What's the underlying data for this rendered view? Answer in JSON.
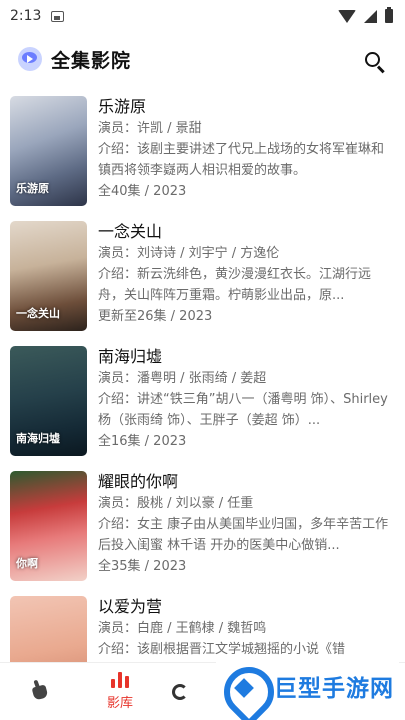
{
  "status_bar": {
    "time": "2:13",
    "icons": [
      "gallery-icon",
      "wifi-icon",
      "signal-icon",
      "battery-icon"
    ]
  },
  "header": {
    "title": "全集影院",
    "logo_icon": "play-cloud-logo",
    "search_icon": "search-icon"
  },
  "shows": [
    {
      "title": "乐游原",
      "actors": "演员：许凯 / 景甜",
      "desc": "介绍：该剧主要讲述了代兄上战场的女将军崔琳和镇西将领李嶷两人相识相爱的故事。",
      "meta": "全40集 / 2023",
      "poster_text": "乐游原"
    },
    {
      "title": "一念关山",
      "actors": "演员：刘诗诗 / 刘宇宁 / 方逸伦",
      "desc": "介绍：新云洗绯色，黄沙漫漫红衣长。江湖行远舟，关山阵阵万重霜。柠萌影业出品，原...",
      "meta": "更新至26集 / 2023",
      "poster_text": "一念关山"
    },
    {
      "title": "南海归墟",
      "actors": "演员：潘粤明 / 张雨绮 / 姜超",
      "desc": "介绍：讲述“铁三角”胡八一（潘粤明 饰）、Shirley杨（张雨绮 饰）、王胖子（姜超 饰）...",
      "meta": "全16集 / 2023",
      "poster_text": "南海归墟"
    },
    {
      "title": "耀眼的你啊",
      "actors": "演员：殷桃 / 刘以豪 / 任重",
      "desc": "介绍：女主 康子由从美国毕业归国，多年辛苦工作后投入闺蜜 林千语 开办的医美中心做销...",
      "meta": "全35集 / 2023",
      "poster_text": "你啊"
    },
    {
      "title": "以爱为营",
      "actors": "演员：白鹿 / 王鹤棣 / 魏哲鸣",
      "desc": "介绍：该剧根据晋江文学城翘摇的小说《错",
      "meta": "",
      "poster_text": ""
    }
  ],
  "bottom_nav": [
    {
      "label": "",
      "icon": "hand-icon"
    },
    {
      "label": "影库",
      "icon": "library-bars-icon",
      "active": true
    },
    {
      "label": "",
      "icon": "partial-icon"
    }
  ],
  "colors": {
    "accent": "#e7342b",
    "watermark": "#1e7be0"
  },
  "watermark": {
    "text": "巨型手游网"
  }
}
